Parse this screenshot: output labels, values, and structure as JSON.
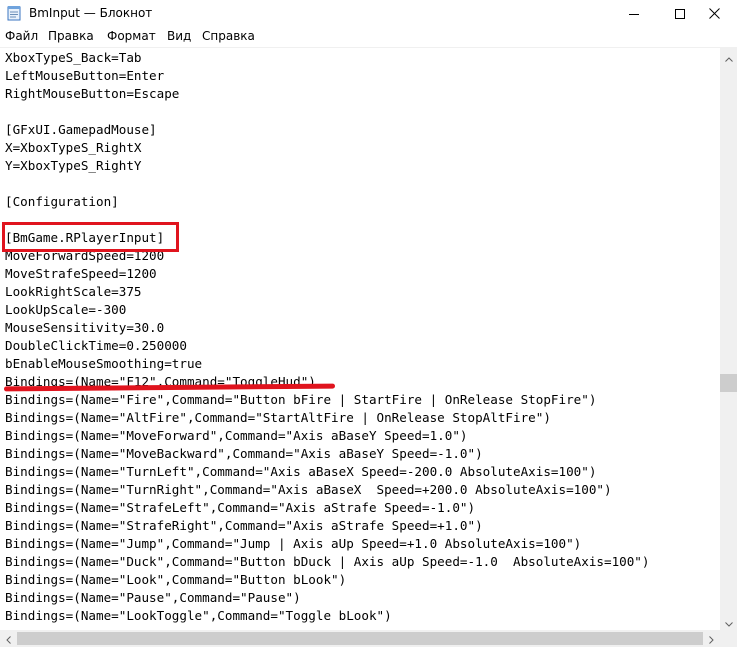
{
  "window": {
    "title": "BmInput — Блокнот",
    "controls": [
      "minimize-icon",
      "maximize-icon",
      "close-icon"
    ]
  },
  "menu": [
    "Файл",
    "Правка",
    "Формат",
    "Вид",
    "Справка"
  ],
  "lines": [
    "XboxTypeS_Back=Tab",
    "LeftMouseButton=Enter",
    "RightMouseButton=Escape",
    "",
    "[GFxUI.GamepadMouse]",
    "X=XboxTypeS_RightX",
    "Y=XboxTypeS_RightY",
    "",
    "[Configuration]",
    "",
    "[BmGame.RPlayerInput]",
    "MoveForwardSpeed=1200",
    "MoveStrafeSpeed=1200",
    "LookRightScale=375",
    "LookUpScale=-300",
    "MouseSensitivity=30.0",
    "DoubleClickTime=0.250000",
    "bEnableMouseSmoothing=true",
    "Bindings=(Name=\"F12\",Command=\"ToggleHud\")",
    "Bindings=(Name=\"Fire\",Command=\"Button bFire | StartFire | OnRelease StopFire\")",
    "Bindings=(Name=\"AltFire\",Command=\"StartAltFire | OnRelease StopAltFire\")",
    "Bindings=(Name=\"MoveForward\",Command=\"Axis aBaseY Speed=1.0\")",
    "Bindings=(Name=\"MoveBackward\",Command=\"Axis aBaseY Speed=-1.0\")",
    "Bindings=(Name=\"TurnLeft\",Command=\"Axis aBaseX Speed=-200.0 AbsoluteAxis=100\")",
    "Bindings=(Name=\"TurnRight\",Command=\"Axis aBaseX  Speed=+200.0 AbsoluteAxis=100\")",
    "Bindings=(Name=\"StrafeLeft\",Command=\"Axis aStrafe Speed=-1.0\")",
    "Bindings=(Name=\"StrafeRight\",Command=\"Axis aStrafe Speed=+1.0\")",
    "Bindings=(Name=\"Jump\",Command=\"Jump | Axis aUp Speed=+1.0 AbsoluteAxis=100\")",
    "Bindings=(Name=\"Duck\",Command=\"Button bDuck | Axis aUp Speed=-1.0  AbsoluteAxis=100\")",
    "Bindings=(Name=\"Look\",Command=\"Button bLook\")",
    "Bindings=(Name=\"Pause\",Command=\"Pause\")",
    "Bindings=(Name=\"LookToggle\",Command=\"Toggle bLook\")"
  ],
  "annotations": {
    "highlight_box_color": "#e0141e",
    "underline_color": "#e0141e"
  }
}
